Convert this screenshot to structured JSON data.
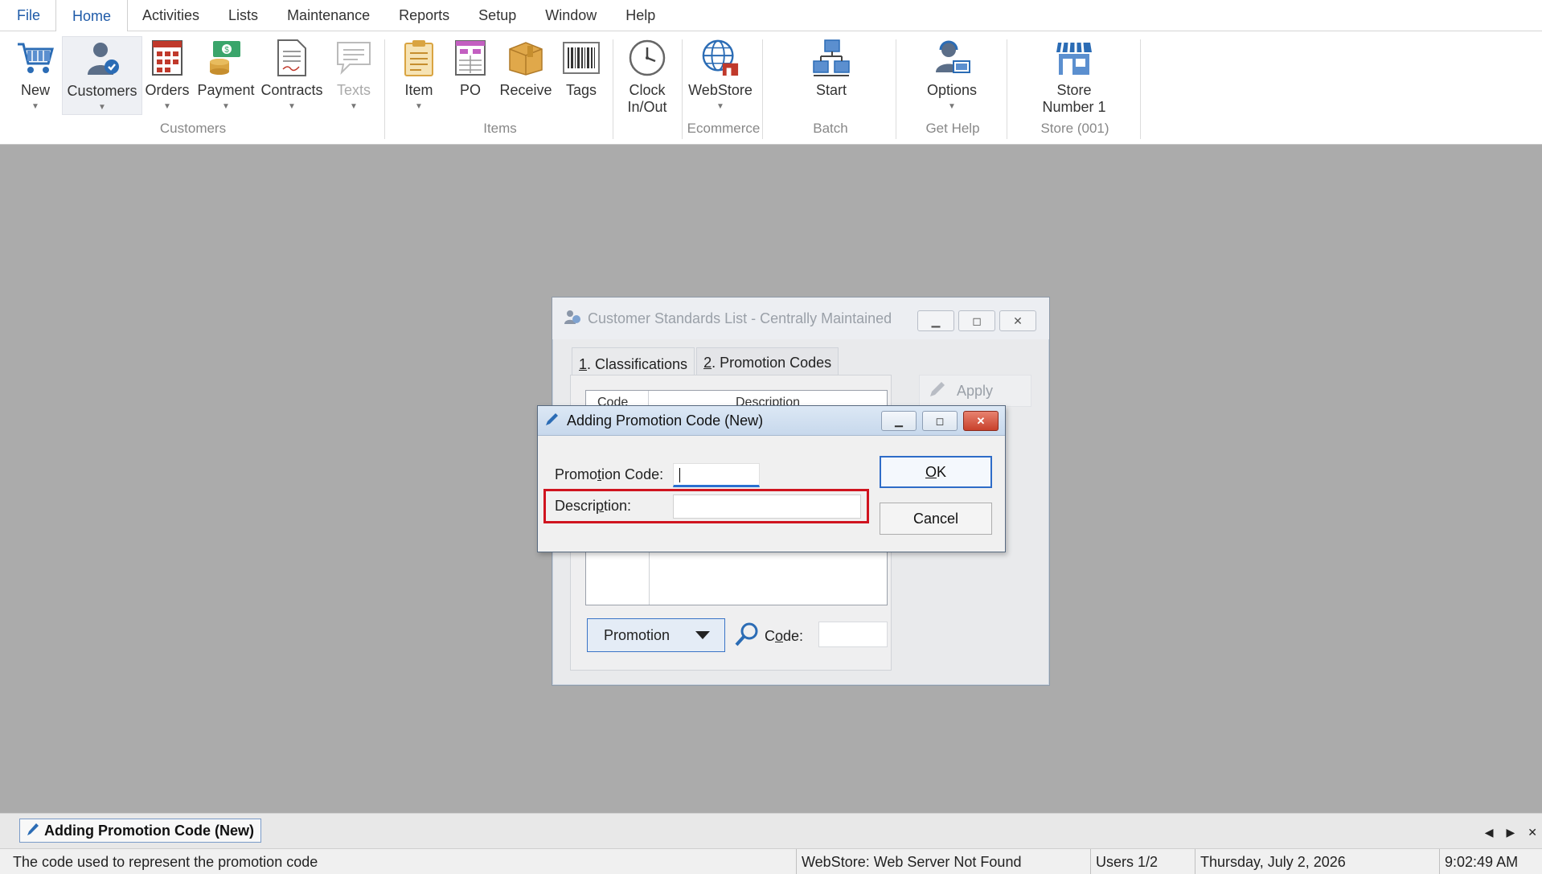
{
  "menu": {
    "items": [
      "File",
      "Home",
      "Activities",
      "Lists",
      "Maintenance",
      "Reports",
      "Setup",
      "Window",
      "Help"
    ],
    "active": "Home"
  },
  "ribbon": {
    "buttons": {
      "new": "New",
      "customers": "Customers",
      "orders": "Orders",
      "payment": "Payment",
      "contracts": "Contracts",
      "texts": "Texts",
      "item": "Item",
      "po": "PO",
      "receive": "Receive",
      "tags": "Tags",
      "clock_line1": "Clock",
      "clock_line2": "In/Out",
      "webstore": "WebStore",
      "start": "Start",
      "options": "Options",
      "store_line1": "Store",
      "store_line2": "Number 1"
    },
    "groups": {
      "customers": "Customers",
      "items": "Items",
      "ecommerce": "Ecommerce",
      "batch": "Batch",
      "get_help": "Get Help",
      "store": "Store (001)"
    },
    "colors": {
      "accent": "#1e5aa8",
      "brand_blue": "#2b6cb5",
      "brand_red": "#c0392b",
      "gold": "#d9a441"
    }
  },
  "bg_window": {
    "title": "Customer Standards List - Centrally Maintained",
    "tab1_num": "1",
    "tab1_label": ". Classifications",
    "tab2_num": "2",
    "tab2_label": ". Promotion Codes",
    "apply_label": "Apply",
    "grid_col1": "Code",
    "grid_col2": "Description",
    "dropdown_value": "Promotion",
    "code_label_pre": "C",
    "code_label_acc": "o",
    "code_label_post": "de:"
  },
  "dialog": {
    "title": "Adding Promotion Code  (New)",
    "promo_code_pre": "Promo",
    "promo_code_acc": "t",
    "promo_code_post": "ion Code:",
    "promo_code_value": "",
    "description_pre": "Descri",
    "description_acc": "p",
    "description_post": "tion:",
    "description_value": "",
    "ok_acc": "O",
    "ok_post": "K",
    "cancel_label": "Cancel",
    "highlight_color": "#d0141f"
  },
  "taskbar": {
    "open_window": "Adding Promotion Code  (New)"
  },
  "status": {
    "hint": "The code used to represent the promotion code",
    "webstore": "WebStore: Web Server Not Found",
    "users": "Users 1/2",
    "date": "Thursday, July  2, 2026",
    "time": "9:02:49 AM"
  }
}
